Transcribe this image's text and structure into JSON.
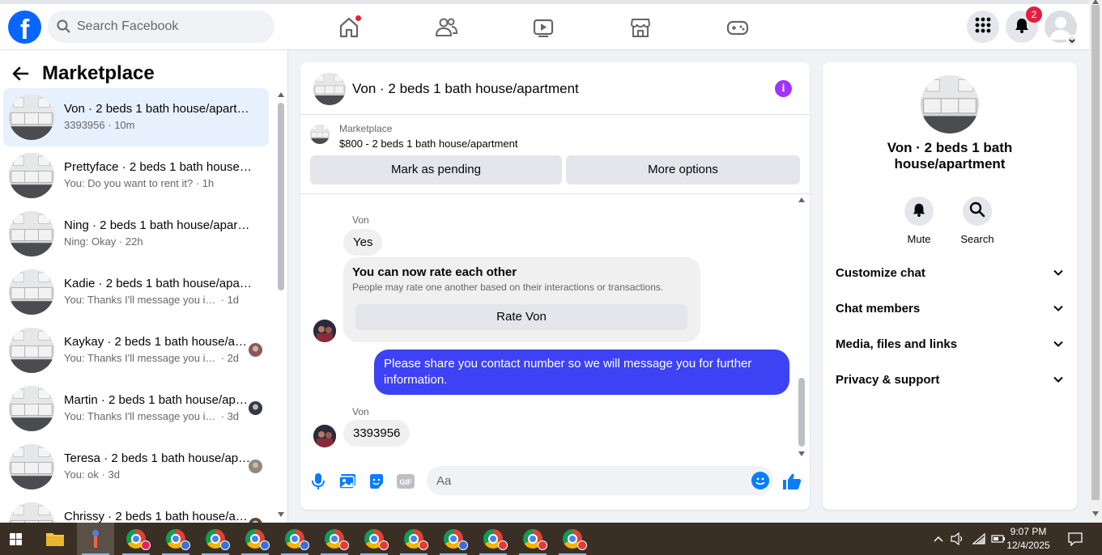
{
  "topbar": {
    "search_placeholder": "Search Facebook",
    "notification_count": "2",
    "nav_items": [
      "home-icon",
      "friends-icon",
      "watch-icon",
      "marketplace-icon",
      "gaming-icon"
    ]
  },
  "left_panel": {
    "title": "Marketplace",
    "conversations": [
      {
        "name": "Von · 2 beds 1 bath house/apartment",
        "preview": "3393956",
        "time": "10m",
        "active": true,
        "has_avatar": false
      },
      {
        "name": "Prettyface · 2 beds 1 bath house/apartment",
        "preview": "You: Do you want to rent it?",
        "time": "1h",
        "active": false,
        "has_avatar": false
      },
      {
        "name": "Ning · 2 beds 1 bath house/apartment",
        "preview": "Ning: Okay",
        "time": "22h",
        "active": false,
        "has_avatar": false
      },
      {
        "name": "Kadie · 2 beds 1 bath house/apartment",
        "preview": "You: Thanks I'll message you in a m...",
        "time": "1d",
        "active": false,
        "has_avatar": false
      },
      {
        "name": "Kaykay · 2 beds 1 bath house/apartment",
        "preview": "You: Thanks I'll message you in ...",
        "time": "2d",
        "active": false,
        "has_avatar": true
      },
      {
        "name": "Martin · 2 beds 1 bath house/apartment",
        "preview": "You: Thanks I'll message you in ...",
        "time": "3d",
        "active": false,
        "has_avatar": true
      },
      {
        "name": "Teresa · 2 beds 1 bath house/apartment",
        "preview": "You: ok",
        "time": "3d",
        "active": false,
        "has_avatar": true
      },
      {
        "name": "Chrissy · 2 beds 1 bath house/apartment",
        "preview": "",
        "time": "",
        "active": false,
        "has_avatar": true
      }
    ]
  },
  "chat": {
    "title": "Von · 2 beds 1 bath house/apartment",
    "listing_source": "Marketplace",
    "listing_price_title": "$800 - 2 beds 1 bath house/apartment",
    "mark_pending_label": "Mark as pending",
    "more_options_label": "More options",
    "messages": {
      "sender_1": "Von",
      "msg_1": "Yes",
      "rate_title": "You can now rate each other",
      "rate_desc": "People may rate one another based on their interactions or transactions.",
      "rate_button": "Rate Von",
      "outgoing": "Please share you contact number so we will message you for further information.",
      "sender_2": "Von",
      "msg_2": "3393956"
    },
    "composer_placeholder": "Aa"
  },
  "info_panel": {
    "title": "Von · 2 beds 1 bath house/apartment",
    "mute_label": "Mute",
    "search_label": "Search",
    "sections": [
      "Customize chat",
      "Chat members",
      "Media, files and links",
      "Privacy & support"
    ]
  },
  "taskbar": {
    "time": "9:07 PM",
    "date": "12/4/2025"
  },
  "colors": {
    "brand_blue": "#0866ff",
    "outgoing_bubble": "#3e42f5",
    "active_conversation": "#e7f0fd",
    "notification_red": "#e41e3f",
    "info_purple": "#a033ff"
  }
}
